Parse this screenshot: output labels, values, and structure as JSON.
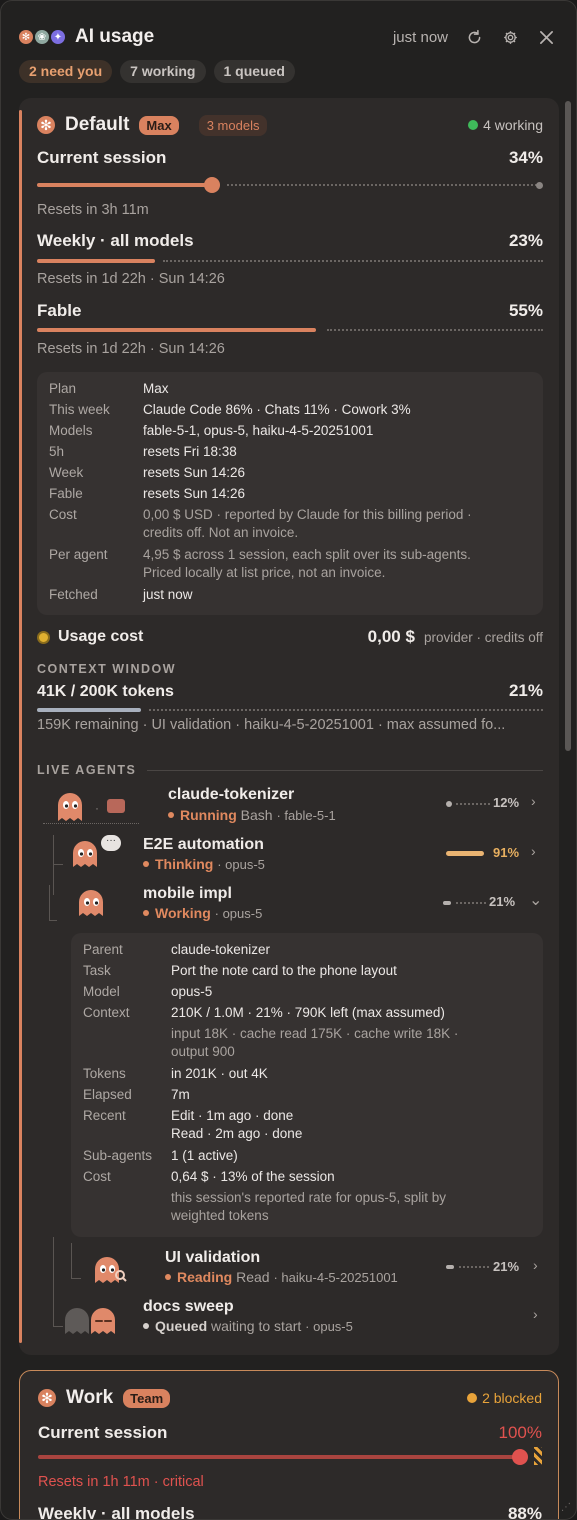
{
  "header": {
    "title": "AI usage",
    "updated": "just now",
    "chips": [
      "2 need you",
      "7 working",
      "1 queued"
    ]
  },
  "default": {
    "name": "Default",
    "tier": "Max",
    "models_badge": "3 models",
    "status": "4 working",
    "current": {
      "label": "Current session",
      "pct": "34%",
      "value": 0.34,
      "reset": "Resets in 3h 11m"
    },
    "weekly": {
      "label": "Weekly · all models",
      "pct": "23%",
      "value": 0.23,
      "reset": "Resets in 1d 22h · Sun 14:26"
    },
    "fable": {
      "label": "Fable",
      "pct": "55%",
      "value": 0.55,
      "reset": "Resets in 1d 22h · Sun 14:26"
    },
    "info": {
      "plan_l": "Plan",
      "plan": "Max",
      "week_l": "This week",
      "week": "Claude Code 86% · Chats 11% · Cowork 3%",
      "models_l": "Models",
      "models": "fable-5-1, opus-5, haiku-4-5-20251001",
      "h5_l": "5h",
      "h5": "resets Fri 18:38",
      "weekr_l": "Week",
      "weekr": "resets Sun 14:26",
      "fable_l": "Fable",
      "fable": "resets Sun 14:26",
      "cost_l": "Cost",
      "cost_1": "0,00 $ USD · reported by Claude for this billing period ·",
      "cost_2": "credits off. Not an invoice.",
      "per_l": "Per agent",
      "per_1": "4,95 $ across 1 session, each split over its sub-agents.",
      "per_2": "Priced locally at list price, not an invoice.",
      "fetched_l": "Fetched",
      "fetched": "just now"
    },
    "usage_cost": {
      "label": "Usage cost",
      "value": "0,00 $",
      "note": "provider · credits off"
    },
    "context": {
      "section": "CONTEXT WINDOW",
      "label": "41K / 200K tokens",
      "pct": "21%",
      "value": 0.21,
      "detail": "159K remaining · UI validation · haiku-4-5-20251001 · max assumed fo..."
    },
    "agents_section": "LIVE AGENTS",
    "agents": [
      {
        "name": "claude-tokenizer",
        "state": "Running",
        "tool": "Bash",
        "model": "· fable-5-1",
        "pct": "12%",
        "value": 0.12
      },
      {
        "name": "E2E automation",
        "state": "Thinking",
        "tool": "",
        "model": "· opus-5",
        "pct": "91%",
        "value": 0.91
      },
      {
        "name": "mobile impl",
        "state": "Working",
        "tool": "",
        "model": "· opus-5",
        "pct": "21%",
        "value": 0.21
      },
      {
        "name": "UI validation",
        "state": "Reading",
        "tool": "Read",
        "model": "· haiku-4-5-20251001",
        "pct": "21%",
        "value": 0.21
      },
      {
        "name": "docs sweep",
        "state": "Queued",
        "tool": "waiting to start",
        "model": "· opus-5",
        "pct": "",
        "value": 0
      }
    ],
    "detail": {
      "parent_l": "Parent",
      "parent": "claude-tokenizer",
      "task_l": "Task",
      "task": "Port the note card to the phone layout",
      "model_l": "Model",
      "model": "opus-5",
      "ctx_l": "Context",
      "ctx": "210K / 1.0M · 21% · 790K left (max assumed)",
      "ctx_2": "input 18K · cache read 175K · cache write 18K ·",
      "ctx_3": "output 900",
      "tok_l": "Tokens",
      "tok": "in 201K · out 4K",
      "el_l": "Elapsed",
      "el": "7m",
      "rec_l": "Recent",
      "rec_1": "Edit · 1m ago · done",
      "rec_2": "Read · 2m ago · done",
      "sub_l": "Sub-agents",
      "sub": "1 (1 active)",
      "cost_l": "Cost",
      "cost": "0,64 $ · 13% of the session",
      "cost_2": "this session's reported rate for opus-5, split by",
      "cost_3": "weighted tokens"
    }
  },
  "work": {
    "name": "Work",
    "tier": "Team",
    "status": "2 blocked",
    "current": {
      "label": "Current session",
      "pct": "100%",
      "value": 1.0,
      "reset": "Resets in 1h 11m · critical"
    },
    "weekly": {
      "label": "Weekly · all models",
      "pct": "88%"
    }
  },
  "colors": {
    "accent": "#d9825f",
    "critical": "#e0524f",
    "ok": "#3fba5a",
    "warn": "#e8a33a"
  }
}
